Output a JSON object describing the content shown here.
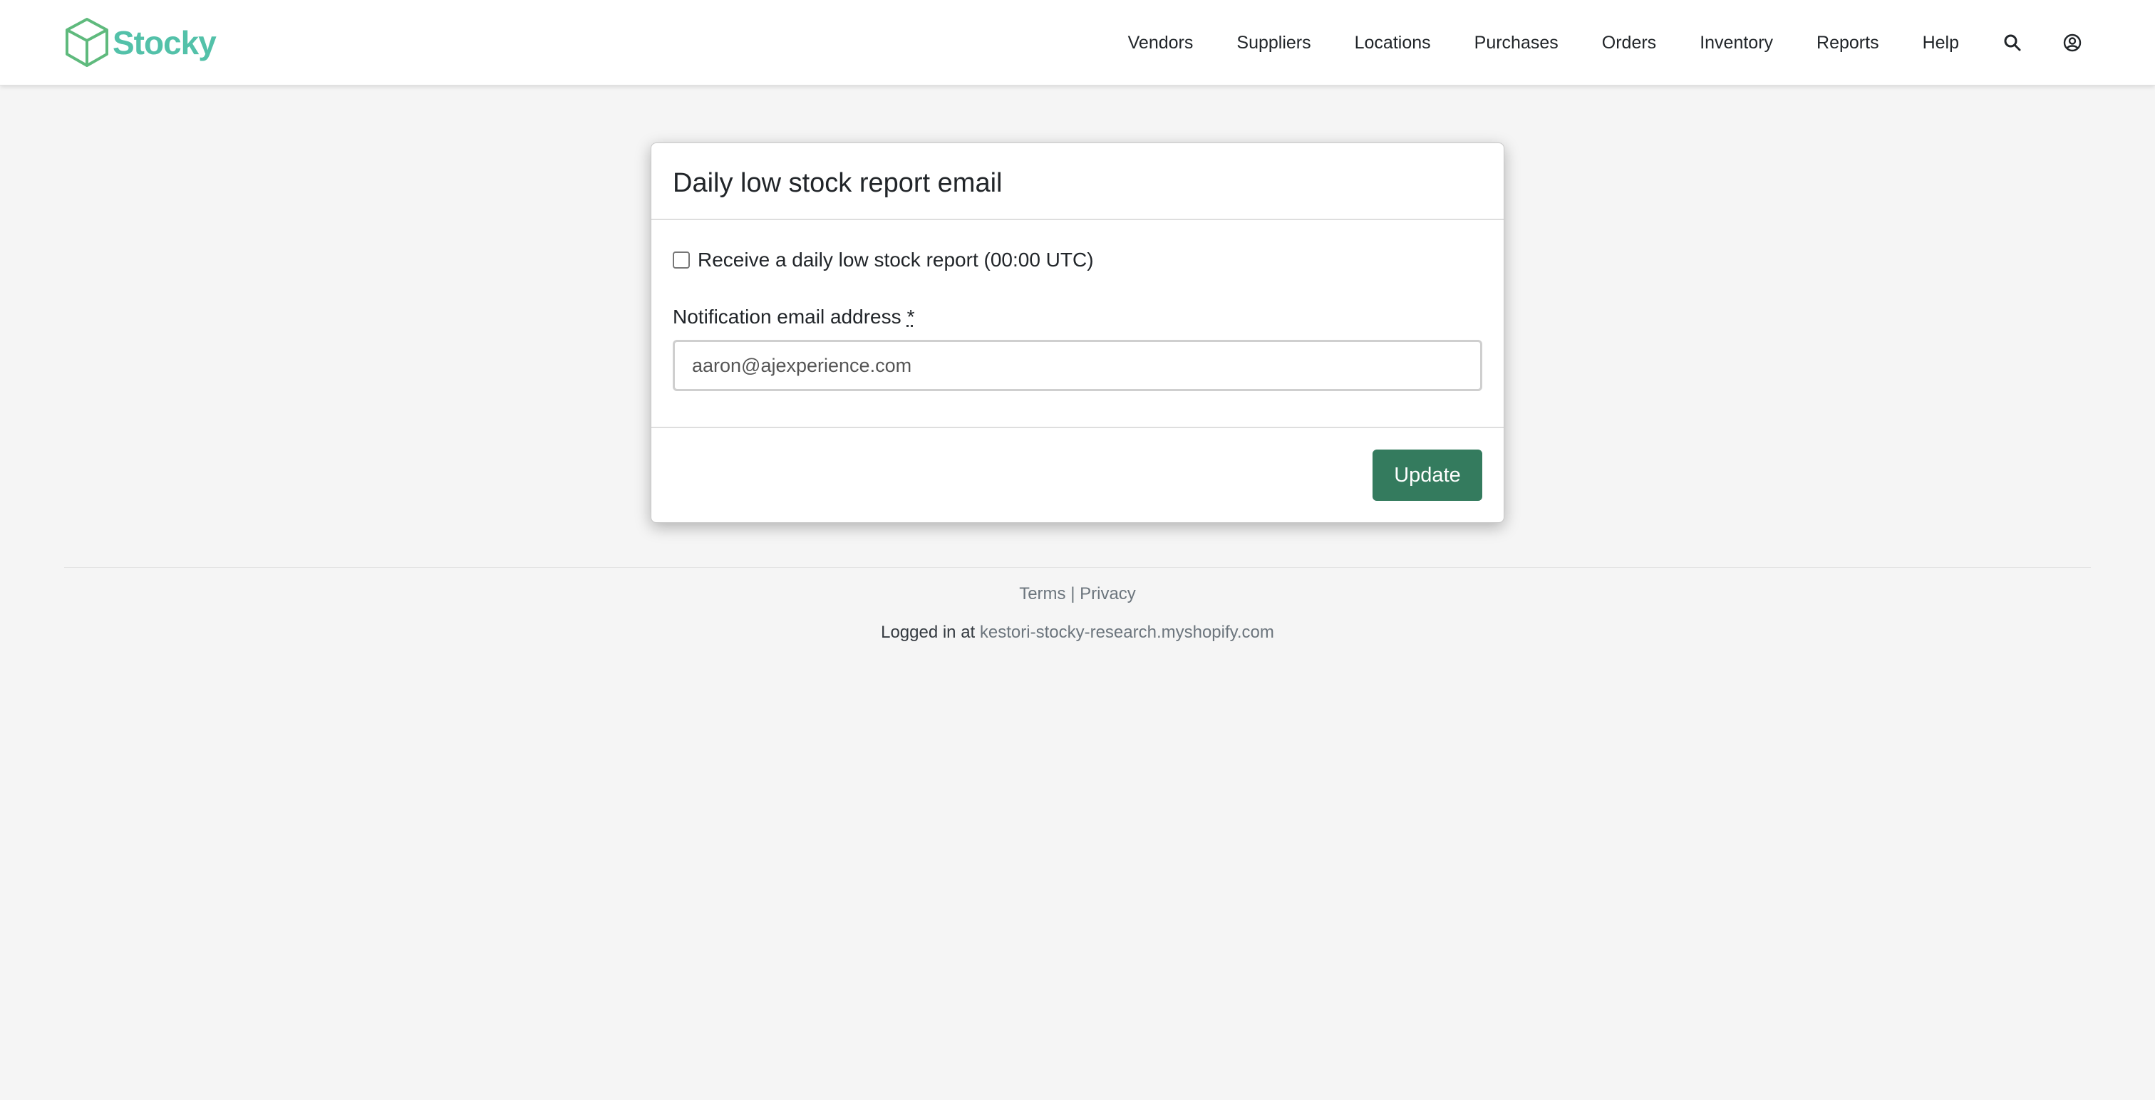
{
  "brand": {
    "name": "Stocky",
    "color": "#53c1a9"
  },
  "nav": {
    "items": [
      "Vendors",
      "Suppliers",
      "Locations",
      "Purchases",
      "Orders",
      "Inventory",
      "Reports",
      "Help"
    ],
    "icons": [
      "search-icon",
      "user-account-icon"
    ]
  },
  "card": {
    "title": "Daily low stock report email",
    "checkbox_label": "Receive a daily low stock report (00:00 UTC)",
    "checkbox_checked": false,
    "email_label": "Notification email address",
    "required_marker": "*",
    "email_value": "aaron@ajexperience.com",
    "update_label": "Update",
    "button_color": "#347b5e"
  },
  "footer": {
    "terms": "Terms",
    "separator": "|",
    "privacy": "Privacy",
    "logged_in_prefix": "Logged in at",
    "shop_domain": "kestori-stocky-research.myshopify.com"
  }
}
